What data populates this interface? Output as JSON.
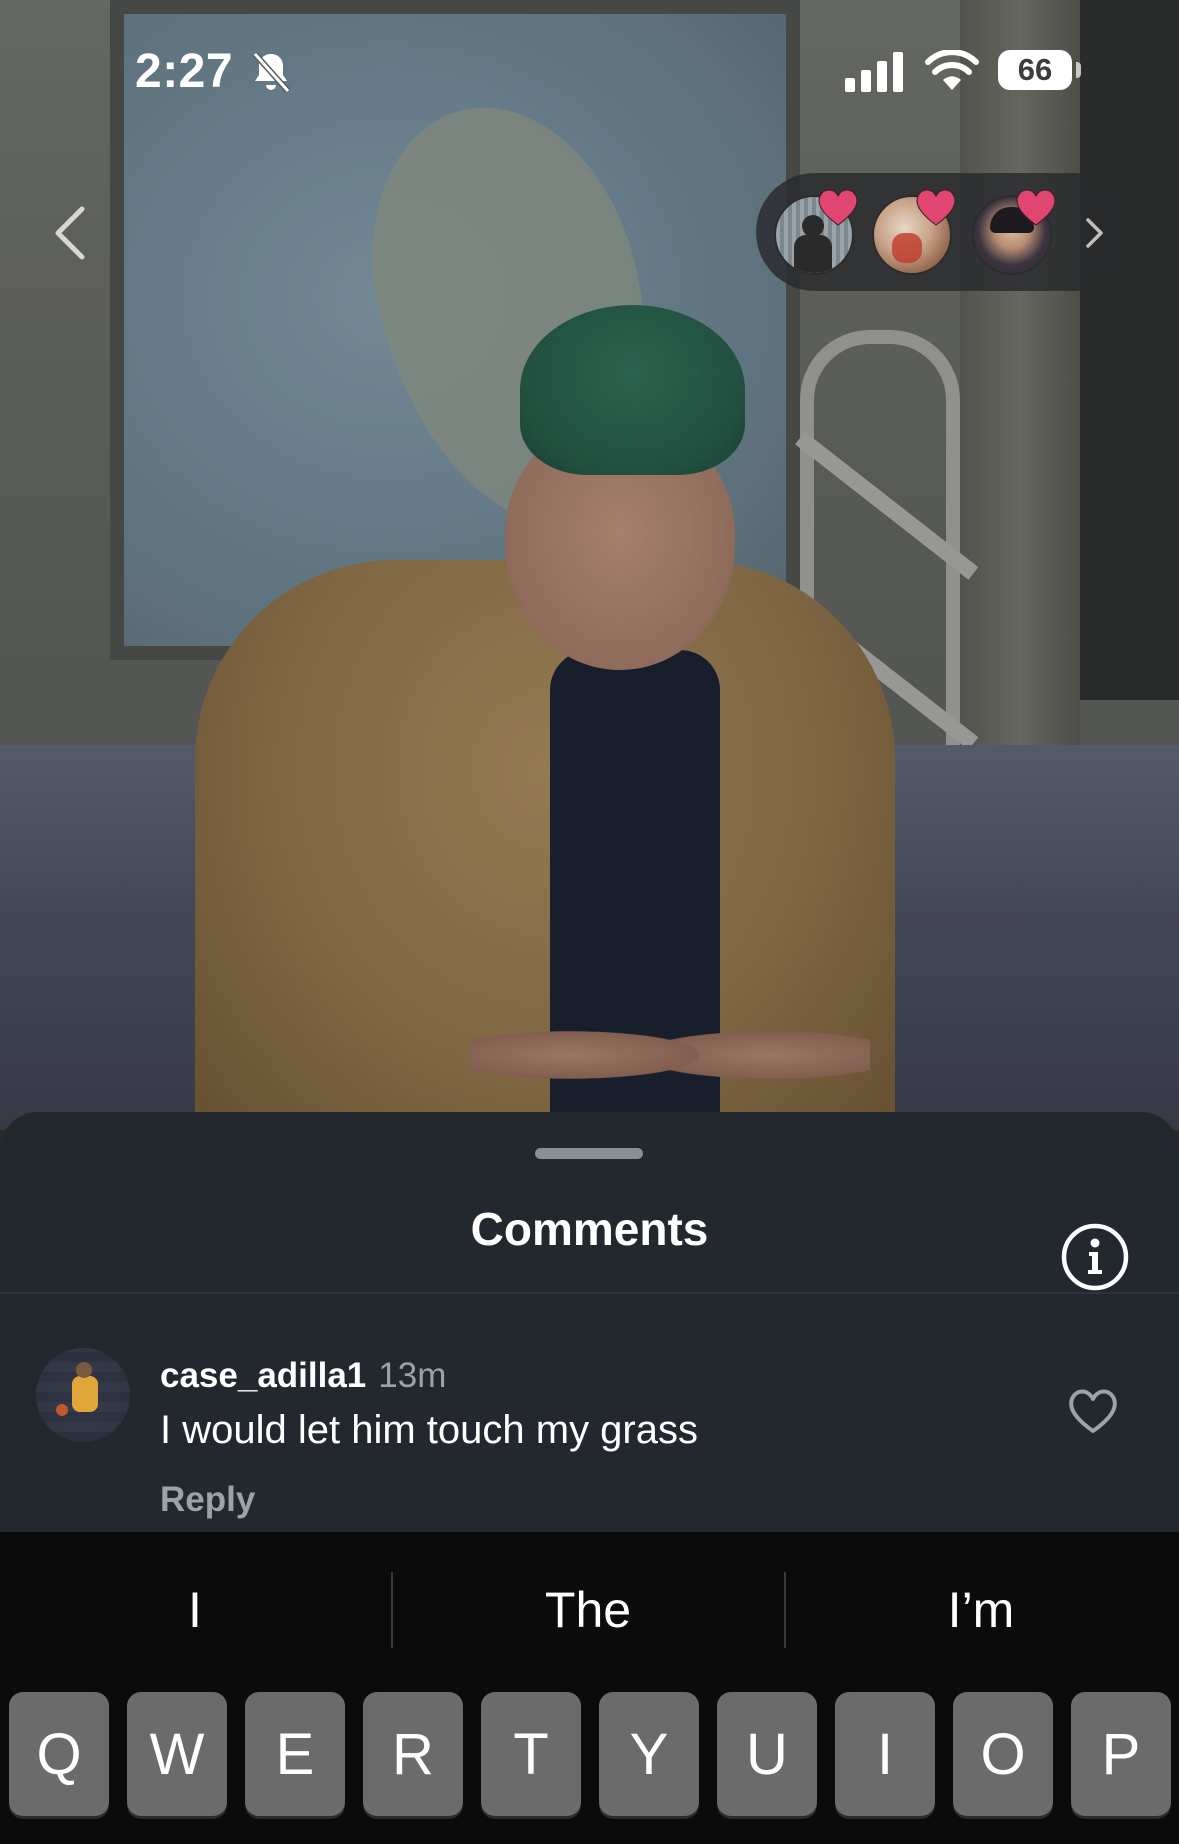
{
  "status_bar": {
    "time": "2:27",
    "battery": "66",
    "icons": [
      "bell-slash-icon",
      "cellular-signal-icon",
      "wifi-icon",
      "battery-icon"
    ]
  },
  "story": {
    "back_icon": "chevron-left-icon",
    "viewers": [
      {
        "icon": "heart-icon",
        "color": "#e0466f"
      },
      {
        "icon": "heart-icon",
        "color": "#e0466f"
      },
      {
        "icon": "heart-icon",
        "color": "#e0466f"
      }
    ],
    "viewers_more_icon": "chevron-right-icon"
  },
  "comments": {
    "title": "Comments",
    "info_icon": "info-icon",
    "items": [
      {
        "username": "case_adilla1",
        "time": "13m",
        "text": "I would let him touch my grass",
        "reply_label": "Reply",
        "like_icon": "heart-outline-icon"
      }
    ]
  },
  "keyboard": {
    "suggestions": [
      "I",
      "The",
      "I’m"
    ],
    "keys": [
      "Q",
      "W",
      "E",
      "R",
      "T",
      "Y",
      "U",
      "I",
      "O",
      "P"
    ]
  },
  "colors": {
    "sheet_background": "#23272e",
    "heart_accent": "#e0466f",
    "secondary_text": "#9ca1aa",
    "key_background": "#6b6b6b"
  }
}
